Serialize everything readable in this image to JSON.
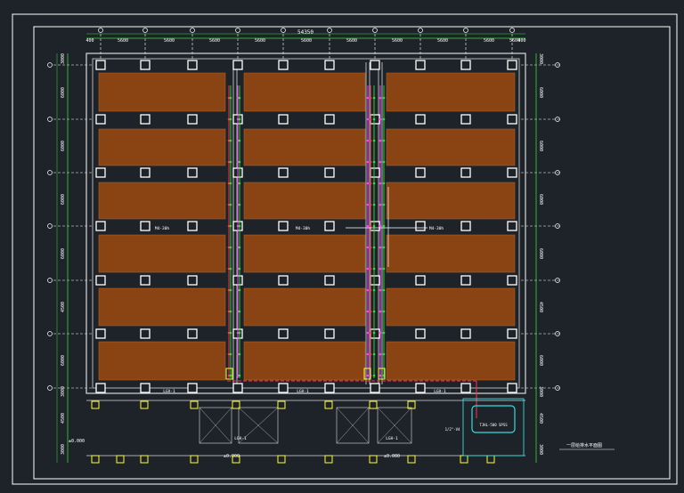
{
  "drawing": {
    "background": "#1e232a",
    "frame_color": "#ffffff",
    "dim_color": "#33dd33",
    "axis_color": "#ffffff",
    "wall_color": "#d8d8d8",
    "panel_color": "#8a4312",
    "column_color": "#ffffff",
    "pipe_colors": [
      "#33dd33",
      "#ff3355",
      "#ff44ff",
      "#ffff33",
      "#33dddd"
    ]
  },
  "top_dimensions": {
    "total": "54350",
    "spans": [
      "400",
      "5600",
      "5600",
      "5600",
      "5600",
      "5600",
      "5600",
      "5600",
      "5600",
      "5600",
      "5600",
      "400"
    ]
  },
  "right_dimensions": {
    "spans": [
      "3000",
      "6000",
      "6000",
      "6000",
      "6000",
      "4500",
      "6000",
      "3000",
      "4500",
      "3000"
    ]
  },
  "left_dimensions": {
    "spans": [
      "3000",
      "6000",
      "6000",
      "6000",
      "6000",
      "4500",
      "6000",
      "3000",
      "4500",
      "3000"
    ],
    "level": "±0.000"
  },
  "room_labels": [
    "M4-30h",
    "M4-30h",
    "M4-30h"
  ],
  "bottom_labels": {
    "beam_marks": [
      "LGH-1",
      "LGH-1",
      "LGH-1",
      "LGH-1",
      "LGH-1"
    ],
    "levels": [
      "±0.000",
      "±0.000"
    ],
    "equipment": "TJHL-500 SPSS",
    "valve_tag": "1/2\"-V4",
    "note": "一层给排水平面图"
  }
}
